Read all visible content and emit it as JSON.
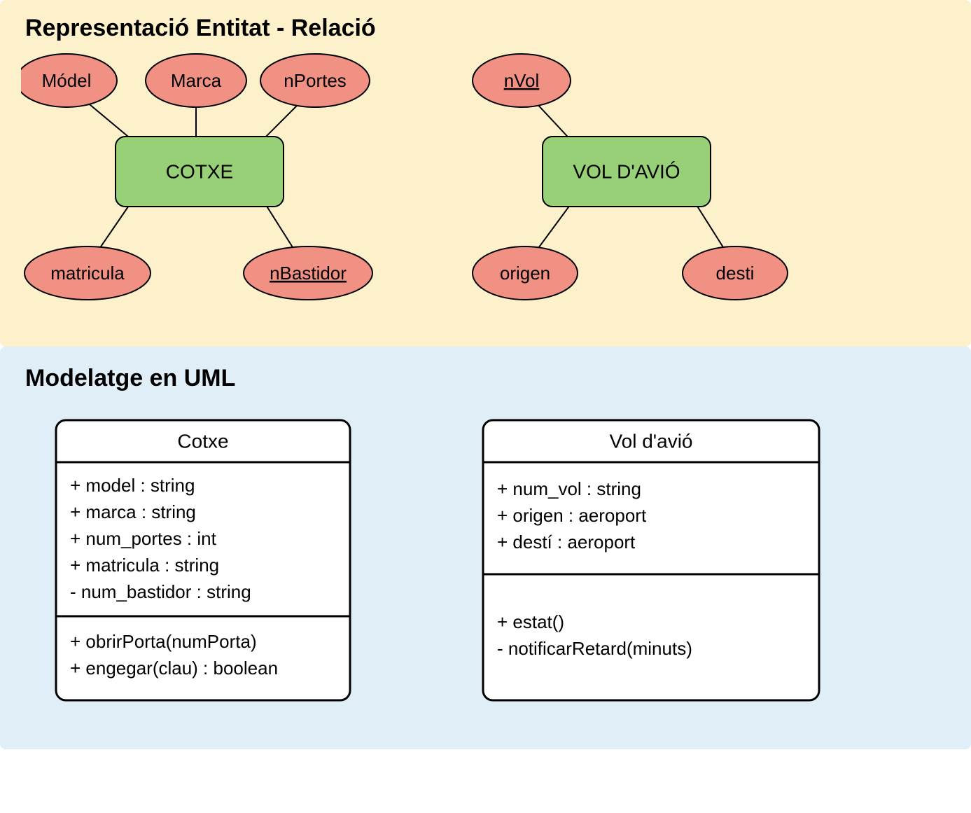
{
  "er": {
    "title": "Representació Entitat - Relació",
    "entities": {
      "cotxe": {
        "label": "COTXE",
        "attrs": {
          "model": {
            "text": "Módel",
            "pk": false
          },
          "marca": {
            "text": "Marca",
            "pk": false
          },
          "nportes": {
            "text": "nPortes",
            "pk": false
          },
          "matricula": {
            "text": "matricula",
            "pk": false
          },
          "nbastidor": {
            "text": "nBastidor",
            "pk": true
          }
        }
      },
      "vol": {
        "label": "VOL D'AVIÓ",
        "attrs": {
          "nvol": {
            "text": "nVol",
            "pk": true
          },
          "origen": {
            "text": "origen",
            "pk": false
          },
          "desti": {
            "text": "desti",
            "pk": false
          }
        }
      }
    }
  },
  "uml": {
    "title": "Modelatge en UML",
    "classes": {
      "cotxe": {
        "name": "Cotxe",
        "attrs": [
          "+ model : string",
          "+ marca : string",
          "+ num_portes : int",
          "+ matricula : string",
          "- num_bastidor : string"
        ],
        "ops": [
          "+ obrirPorta(numPorta)",
          "+ engegar(clau) : boolean"
        ]
      },
      "vol": {
        "name": "Vol d'avió",
        "attrs": [
          "+ num_vol : string",
          "+ origen : aeroport",
          "+ destí : aeroport"
        ],
        "ops": [
          "+ estat()",
          "- notificarRetard(minuts)"
        ]
      }
    }
  }
}
